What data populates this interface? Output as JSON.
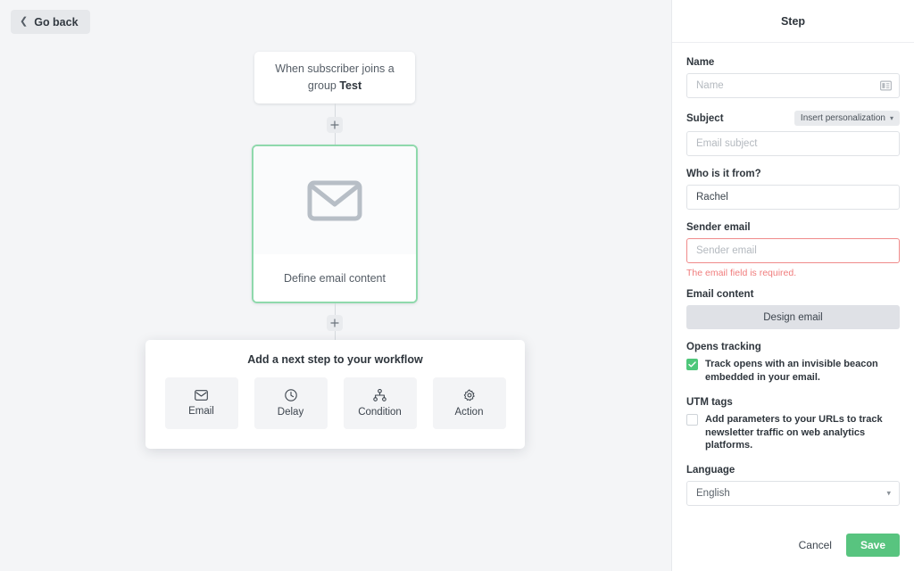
{
  "canvas": {
    "go_back_label": "Go back",
    "trigger": {
      "text_prefix": "When subscriber joins a group ",
      "group_name": "Test"
    },
    "email_step": {
      "label": "Define email content"
    },
    "next_step": {
      "title": "Add a next step to your workflow",
      "options": [
        {
          "label": "Email",
          "icon": "envelope-icon"
        },
        {
          "label": "Delay",
          "icon": "clock-icon"
        },
        {
          "label": "Condition",
          "icon": "node-tree-icon"
        },
        {
          "label": "Action",
          "icon": "gear-icon"
        }
      ]
    }
  },
  "panel": {
    "title": "Step",
    "name": {
      "label": "Name",
      "value": "",
      "placeholder": "Name",
      "icon": "personalization-card-icon"
    },
    "subject": {
      "label": "Subject",
      "personalization_button": "Insert personalization",
      "value": "",
      "placeholder": "Email subject"
    },
    "sender_name": {
      "label": "Who is it from?",
      "value": "Rachel",
      "placeholder": "Who is it from?"
    },
    "sender_email": {
      "label": "Sender email",
      "value": "",
      "placeholder": "Sender email",
      "error": "The email field is required."
    },
    "email_content": {
      "label": "Email content",
      "button": "Design email"
    },
    "opens_tracking": {
      "label": "Opens tracking",
      "checkbox_text": "Track opens with an invisible beacon embedded in your email.",
      "checked": true
    },
    "utm_tags": {
      "label": "UTM tags",
      "checkbox_text": "Add parameters to your URLs to track newsletter traffic on web analytics platforms.",
      "checked": false
    },
    "language": {
      "label": "Language",
      "value": "English"
    },
    "footer": {
      "cancel_label": "Cancel",
      "save_label": "Save"
    }
  },
  "colors": {
    "accent_green": "#58c47f",
    "selected_border": "#8fd9ac",
    "error_red": "#f07c7c",
    "canvas_bg": "#f4f5f7"
  }
}
